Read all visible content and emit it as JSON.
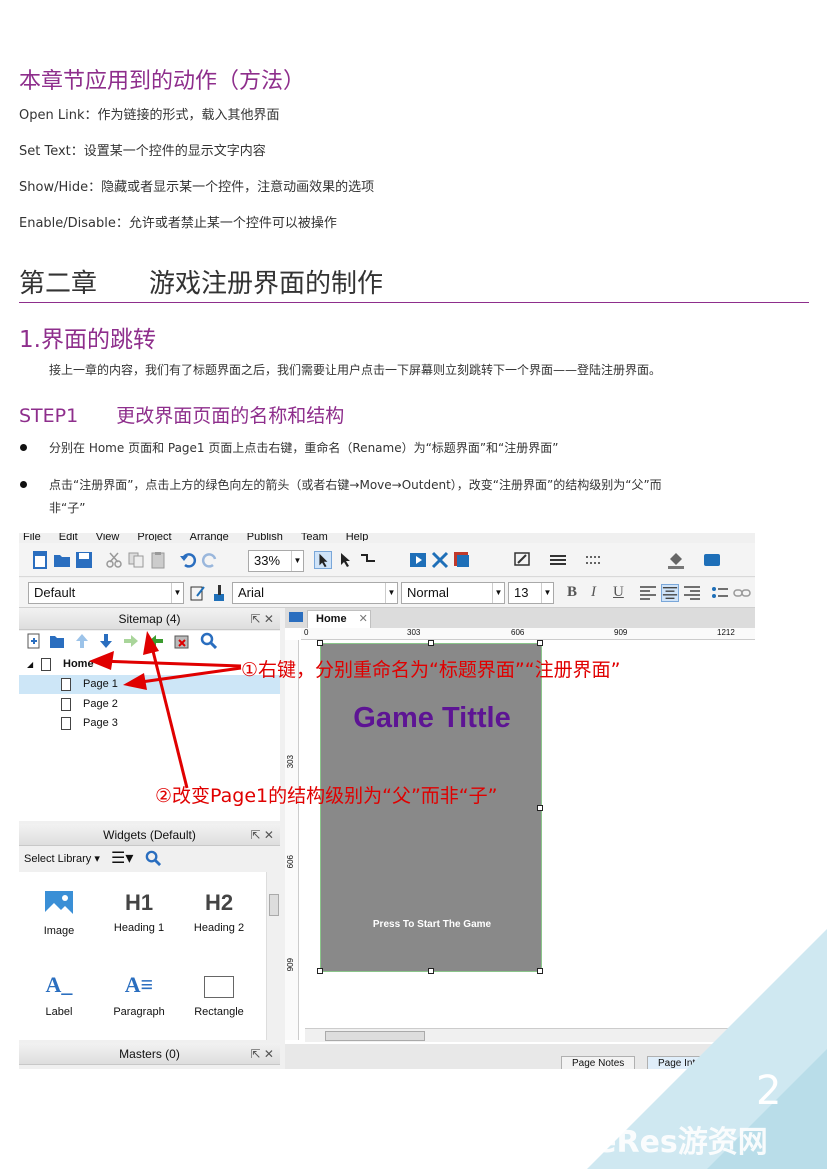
{
  "doc": {
    "section_title": "本章节应用到的动作（方法）",
    "actions": [
      "Open Link：作为链接的形式，载入其他界面",
      "Set Text：设置某一个控件的显示文字内容",
      "Show/Hide：隐藏或者显示某一个控件，注意动画效果的选项",
      "Enable/Disable：允许或者禁止某一个控件可以被操作"
    ],
    "chapter_title": "第二章　　游戏注册界面的制作",
    "subsection_title": "1.界面的跳转",
    "intro": "接上一章的内容，我们有了标题界面之后，我们需要让用户点击一下屏幕则立刻跳转下一个界面——登陆注册界面。",
    "step_title": "STEP1　　更改界面页面的名称和结构",
    "bullets": [
      "分别在 Home 页面和 Page1 页面上点击右键，重命名（Rename）为“标题界面”和“注册界面”",
      "点击“注册界面”，点击上方的绿色向左的箭头（或者右键→Move→Outdent），改变“注册界面”的结构级别为“父”而",
      "非“子”"
    ],
    "page_number": "2",
    "watermark": "GameRes游资网"
  },
  "app": {
    "menu": [
      "File",
      "Edit",
      "View",
      "Project",
      "Arrange",
      "Publish",
      "Team",
      "Help"
    ],
    "zoom": "33%",
    "style_select": "Default",
    "font_select": "Arial",
    "weight_select": "Normal",
    "size_select": "13",
    "sitemap_title": "Sitemap (4)",
    "pages": [
      "Home",
      "Page 1",
      "Page 2",
      "Page 3"
    ],
    "widgets_title": "Widgets (Default)",
    "select_library": "Select Library",
    "widget_items": [
      "Image",
      "Heading 1",
      "Heading 2",
      "Label",
      "Paragraph",
      "Rectangle"
    ],
    "h1_glyph": "H1",
    "h2_glyph": "H2",
    "masters_title": "Masters (0)",
    "tab_home": "Home",
    "ruler_h": [
      "0",
      "303",
      "606",
      "909",
      "1212"
    ],
    "ruler_v": [
      "303",
      "606",
      "909"
    ],
    "artboard_title": "Game Tittle",
    "artboard_press": "Press To Start The Game",
    "bottom_tabs": [
      "Page Notes",
      "Page Interactions *"
    ]
  },
  "annotations": {
    "a1": "①右键，分别重命名为“标题界面”“注册界面”",
    "a2": "②改变Page1的结构级别为“父”而非“子”"
  },
  "colors": {
    "heading": "#8e2e8c",
    "annotation": "#e00000",
    "game_title": "#5d1494"
  }
}
